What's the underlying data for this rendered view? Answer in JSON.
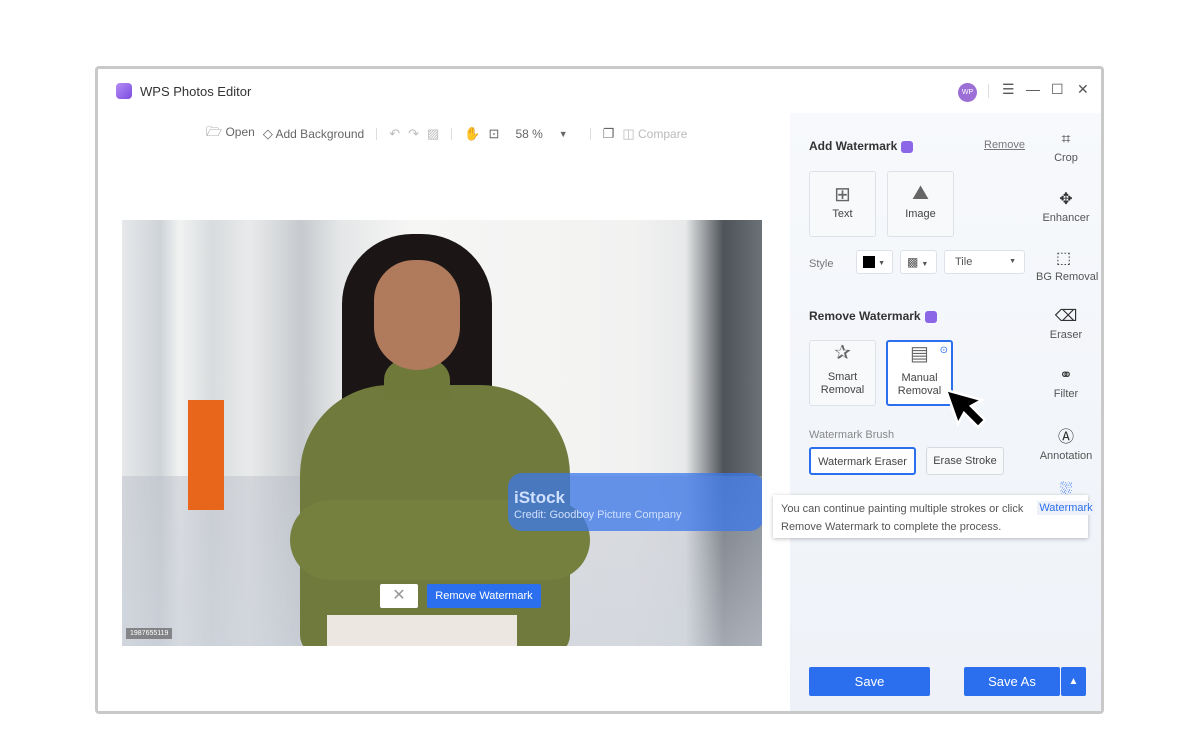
{
  "app": {
    "title": "WPS Photos Editor",
    "avatar": "WP"
  },
  "window_controls": {
    "menu": "☰",
    "minimize": "—",
    "maximize": "☐",
    "close": "✕"
  },
  "toolbar": {
    "open": "Open",
    "add_background": "Add Background",
    "zoom": "58 %",
    "compare": "Compare"
  },
  "canvas": {
    "watermark_title": "iStock",
    "watermark_credit": "Credit: Goodboy Picture Company",
    "image_id": "1987655119",
    "cancel": "✕",
    "remove_watermark": "Remove Watermark"
  },
  "panel": {
    "add_watermark": "Add Watermark",
    "remove_link": "Remove",
    "text": "Text",
    "image": "Image",
    "style": "Style",
    "tile": "Tile",
    "remove_watermark": "Remove Watermark",
    "smart_removal_1": "Smart",
    "smart_removal_2": "Removal",
    "manual_removal_1": "Manual",
    "manual_removal_2": "Removal",
    "brush_label": "Watermark Brush",
    "watermark_eraser": "Watermark Eraser",
    "erase_stroke": "Erase Stroke",
    "save": "Save",
    "save_as": "Save As"
  },
  "tools": [
    {
      "label": "Crop"
    },
    {
      "label": "Enhancer"
    },
    {
      "label": "BG Removal"
    },
    {
      "label": "Eraser"
    },
    {
      "label": "Filter"
    },
    {
      "label": "Annotation"
    },
    {
      "label": "Watermark"
    }
  ],
  "tooltip": {
    "line1": "You can continue painting multiple strokes or click",
    "line2": "Remove Watermark to complete the process."
  },
  "colors": {
    "accent": "#2b6fee",
    "badge": "#8b67e8"
  }
}
